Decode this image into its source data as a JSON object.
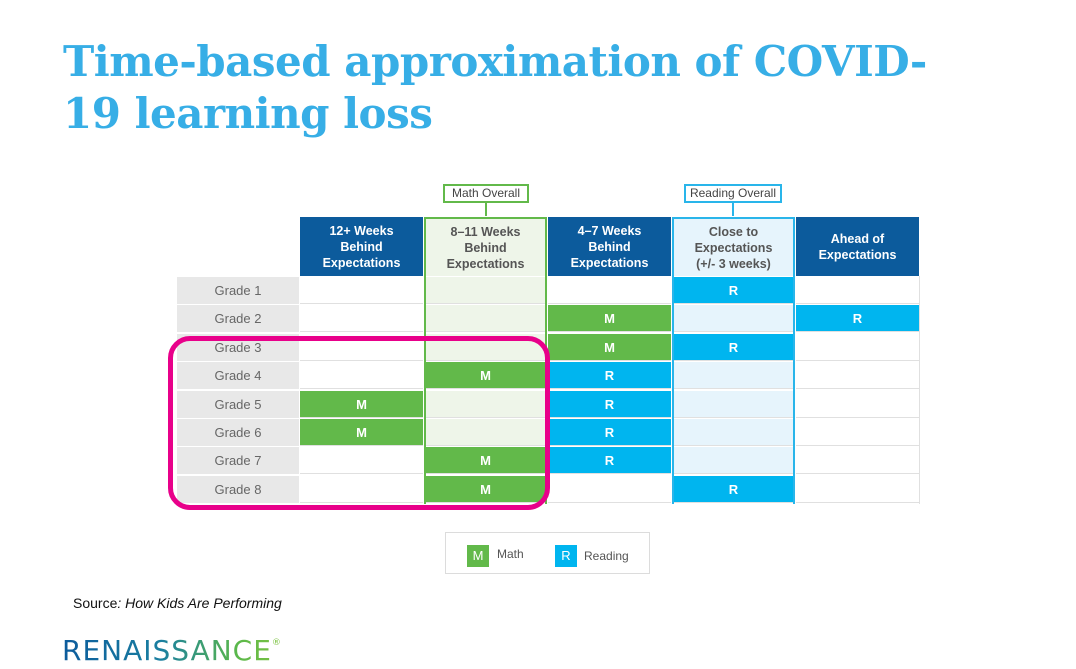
{
  "title": "Time-based approximation of COVID-19 learning loss",
  "chart_data": {
    "type": "table",
    "title": "Time-based approximation of COVID-19 learning loss",
    "columns": [
      "12+ Weeks Behind Expectations",
      "8–11 Weeks Behind Expectations",
      "4–7 Weeks Behind Expectations",
      "Close to Expectations (+/- 3 weeks)",
      "Ahead of Expectations"
    ],
    "column_lines": [
      [
        "12+ Weeks",
        "Behind",
        "Expectations"
      ],
      [
        "8–11 Weeks",
        "Behind",
        "Expectations"
      ],
      [
        "4–7 Weeks",
        "Behind",
        "Expectations"
      ],
      [
        "Close to",
        "Expectations",
        "(+/- 3 weeks)"
      ],
      [
        "Ahead of",
        "Expectations"
      ]
    ],
    "rows": [
      "Grade 1",
      "Grade 2",
      "Grade 3",
      "Grade 4",
      "Grade 5",
      "Grade 6",
      "Grade 7",
      "Grade 8"
    ],
    "cells": [
      [
        "",
        "",
        "",
        "R",
        ""
      ],
      [
        "",
        "",
        "M",
        "",
        "R"
      ],
      [
        "",
        "",
        "M",
        "R",
        ""
      ],
      [
        "",
        "M",
        "R",
        "",
        ""
      ],
      [
        "M",
        "",
        "R",
        "",
        ""
      ],
      [
        "M",
        "",
        "R",
        "",
        ""
      ],
      [
        "",
        "M",
        "R",
        "",
        ""
      ],
      [
        "",
        "M",
        "",
        "R",
        ""
      ]
    ],
    "overall": {
      "math": {
        "label": "Math Overall",
        "column": "8–11 Weeks Behind Expectations"
      },
      "reading": {
        "label": "Reading Overall",
        "column": "Close to Expectations (+/- 3 weeks)"
      }
    },
    "highlighted_rows": [
      "Grade 3",
      "Grade 4",
      "Grade 5",
      "Grade 6",
      "Grade 7",
      "Grade 8"
    ],
    "legend": [
      {
        "symbol": "M",
        "label": "Math",
        "color": "#62b94a"
      },
      {
        "symbol": "R",
        "label": "Reading",
        "color": "#00b5ef"
      }
    ]
  },
  "source": {
    "prefix": "Source",
    "colon": ":",
    "title": " How Kids Are Performing"
  },
  "logo": {
    "text": "RENAISSANCE",
    "mark": "®"
  },
  "colors": {
    "title": "#37aee6",
    "header": "#0c5b9c",
    "math": "#62b94a",
    "reading": "#00b5ef",
    "highlight": "#e8008a"
  }
}
